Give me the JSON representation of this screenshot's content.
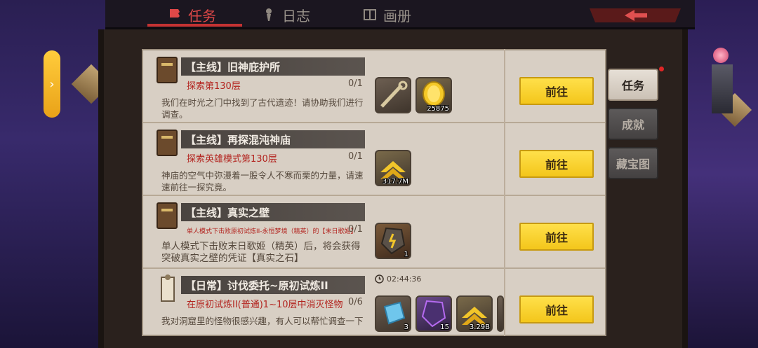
{
  "top_tabs": [
    {
      "label": "任务",
      "icon": "quest-scroll-icon",
      "active": true
    },
    {
      "label": "日志",
      "icon": "torch-icon",
      "active": false
    },
    {
      "label": "画册",
      "icon": "book-icon",
      "active": false
    }
  ],
  "side_tabs": [
    {
      "label": "任务",
      "active": true,
      "has_notification": true
    },
    {
      "label": "成就",
      "active": false
    },
    {
      "label": "藏宝图",
      "active": false
    }
  ],
  "expand_arrow": "›",
  "quests": [
    {
      "title": "【主线】旧神庇护所",
      "objective": "探索第130层",
      "progress": "0/1",
      "description": "我们在时光之门中找到了古代遗迹！请协助我们进行调查。",
      "rewards": [
        {
          "icon": "chain-item-icon",
          "qty": ""
        },
        {
          "icon": "gold-coin-icon",
          "qty": "25875"
        }
      ],
      "button": "前往"
    },
    {
      "title": "【主线】再探混沌神庙",
      "objective": "探索英雄模式第130层",
      "progress": "0/1",
      "description": "神庙的空气中弥漫着一股令人不寒而栗的力量，请速速前往一探究竟。",
      "rewards": [
        {
          "icon": "exp-chevron-icon",
          "qty": "317.7M"
        }
      ],
      "button": "前往"
    },
    {
      "title": "【主线】真实之壁",
      "objective": "单人模式下击败原初试炼II-永恒梦境（精英）的【末日歌姬】",
      "progress": "0/1",
      "description": "单人模式下击败末日歌姬（精英）后，将会获得突破真实之壁的凭证【真实之石】",
      "rewards": [
        {
          "icon": "rune-stone-icon",
          "qty": "1"
        }
      ],
      "button": "前往"
    },
    {
      "title": "【日常】讨伐委托~原初试炼II",
      "objective": "在原初试炼II(普通)1~10层中消灭怪物",
      "progress": "0/6",
      "description": "我对洞窟里的怪物很感兴趣，有人可以帮忙调查一下",
      "timer": "02:44:36",
      "rewards": [
        {
          "icon": "blue-crystal-icon",
          "qty": "3"
        },
        {
          "icon": "purple-rune-icon",
          "qty": "15"
        },
        {
          "icon": "exp-chevron-icon",
          "qty": "3.29B"
        }
      ],
      "button": "前往"
    }
  ]
}
